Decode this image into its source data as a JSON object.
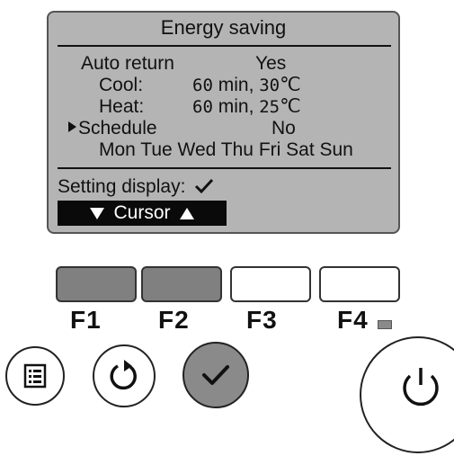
{
  "lcd": {
    "title": "Energy saving",
    "auto_return_label": "Auto return",
    "auto_return_value": "Yes",
    "cool_label": "Cool:",
    "cool_minutes": "60",
    "cool_sep": " min, ",
    "cool_temp": "30",
    "cool_unit": "℃",
    "heat_label": "Heat:",
    "heat_minutes": "60",
    "heat_sep": " min, ",
    "heat_temp": "25",
    "heat_unit": "℃",
    "schedule_label": "Schedule",
    "schedule_value": "No",
    "days": "Mon Tue Wed Thu Fri Sat Sun",
    "setting_display_label": "Setting display:",
    "cursor_label": "Cursor"
  },
  "function_keys": [
    "F1",
    "F2",
    "F3",
    "F4"
  ],
  "buttons": {
    "menu": "menu-icon",
    "return": "return-icon",
    "select": "check-icon",
    "power": "power-icon"
  },
  "colors": {
    "lcd_background": "#b4b4b4",
    "pressed_key": "#808080",
    "select_button": "#8a8a8a"
  }
}
